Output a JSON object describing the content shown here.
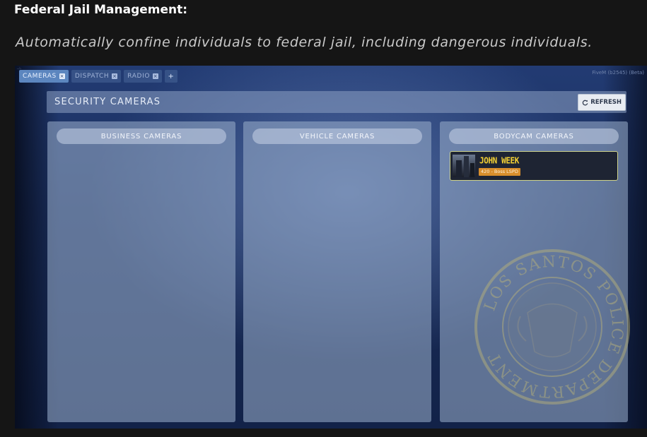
{
  "doc": {
    "title": "Federal Jail Management:",
    "subtitle": "Automatically confine individuals to federal jail, including dangerous individuals."
  },
  "app": {
    "tiny_top_text": "..:.",
    "build_text": "FiveM (b2545) (Beta)",
    "tabs": [
      {
        "label": "CAMERAS",
        "active": true
      },
      {
        "label": "DISPATCH",
        "active": false
      },
      {
        "label": "RADIO",
        "active": false
      }
    ],
    "tab_close_glyph": "×",
    "add_tab_glyph": "+",
    "header": {
      "title": "SECURITY CAMERAS",
      "refresh_label": "REFRESH",
      "refresh_icon": "refresh-icon"
    },
    "panels": [
      {
        "title": "BUSINESS CAMERAS",
        "cards": []
      },
      {
        "title": "VEHICLE CAMERAS",
        "cards": []
      },
      {
        "title": "BODYCAM CAMERAS",
        "cards": [
          {
            "name": "JOHN WEEK",
            "badge": "420 - Boss LSPD"
          }
        ]
      }
    ],
    "seal_text": "LOS SANTOS POLICE DEPARTMENT"
  },
  "colors": {
    "active_tab": "#5c86bf",
    "card_name": "#f2cf34",
    "badge": "#d88e2c",
    "card_border": "#cfd38a"
  }
}
